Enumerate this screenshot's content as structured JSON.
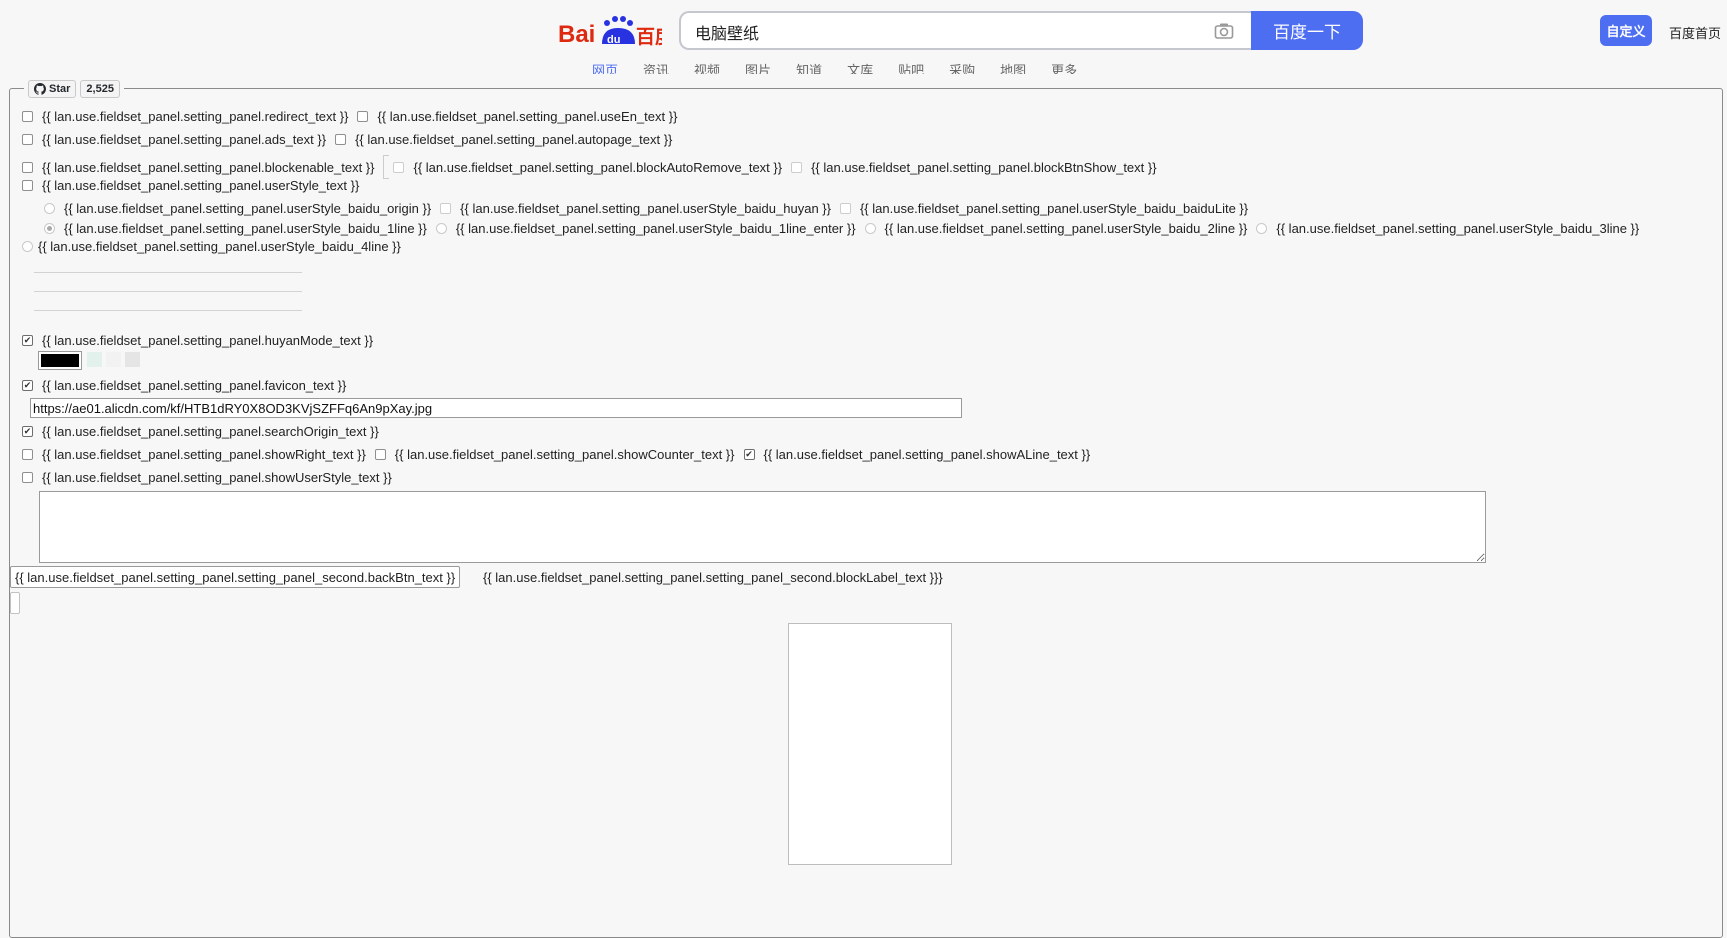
{
  "header": {
    "logo_text": "Bai du 百度",
    "search_value": "电脑壁纸",
    "search_button": "百度一下",
    "customize_button": "自定义",
    "home_link": "百度首页",
    "nav_tabs": [
      "网页",
      "资讯",
      "视频",
      "图片",
      "知道",
      "文库",
      "贴吧",
      "采购",
      "地图",
      "更多"
    ]
  },
  "github": {
    "star_label": "Star",
    "star_count": "2,525"
  },
  "settings": {
    "redirect": "{{ lan.use.fieldset_panel.setting_panel.redirect_text }}",
    "useEn": "{{ lan.use.fieldset_panel.setting_panel.useEn_text }}",
    "ads": "{{ lan.use.fieldset_panel.setting_panel.ads_text }}",
    "autopage": "{{ lan.use.fieldset_panel.setting_panel.autopage_text }}",
    "blockenable": "{{ lan.use.fieldset_panel.setting_panel.blockenable_text }}",
    "blockAutoRemove": "{{ lan.use.fieldset_panel.setting_panel.blockAutoRemove_text }}",
    "blockBtnShow": "{{ lan.use.fieldset_panel.setting_panel.blockBtnShow_text }}",
    "userStyle": "{{ lan.use.fieldset_panel.setting_panel.userStyle_text }}",
    "userStyle_baidu_origin": "{{ lan.use.fieldset_panel.setting_panel.userStyle_baidu_origin }}",
    "userStyle_baidu_huyan": "{{ lan.use.fieldset_panel.setting_panel.userStyle_baidu_huyan }}",
    "userStyle_baidu_baiduLite": "{{ lan.use.fieldset_panel.setting_panel.userStyle_baidu_baiduLite }}",
    "userStyle_baidu_1line": "{{ lan.use.fieldset_panel.setting_panel.userStyle_baidu_1line }}",
    "userStyle_baidu_1line_enter": "{{ lan.use.fieldset_panel.setting_panel.userStyle_baidu_1line_enter }}",
    "userStyle_baidu_2line": "{{ lan.use.fieldset_panel.setting_panel.userStyle_baidu_2line }}",
    "userStyle_baidu_3line": "{{ lan.use.fieldset_panel.setting_panel.userStyle_baidu_3line }}",
    "userStyle_baidu_4line": "{{ lan.use.fieldset_panel.setting_panel.userStyle_baidu_4line }}",
    "huyanMode": "{{ lan.use.fieldset_panel.setting_panel.huyanMode_text }}",
    "favicon": "{{ lan.use.fieldset_panel.setting_panel.favicon_text }}",
    "favicon_url": "https://ae01.alicdn.com/kf/HTB1dRY0X8OD3KVjSZFFq6An9pXay.jpg",
    "searchOrigin": "{{ lan.use.fieldset_panel.setting_panel.searchOrigin_text }}",
    "showRight": "{{ lan.use.fieldset_panel.setting_panel.showRight_text }}",
    "showCounter": "{{ lan.use.fieldset_panel.setting_panel.showCounter_text }}",
    "showALine": "{{ lan.use.fieldset_panel.setting_panel.showALine_text }}",
    "showUserStyle": "{{ lan.use.fieldset_panel.setting_panel.showUserStyle_text }}",
    "backBtn": "{{ lan.use.fieldset_panel.setting_panel.setting_panel_second.backBtn_text }}",
    "blockLabel": "{{ lan.use.fieldset_panel.setting_panel.setting_panel_second.blockLabel_text }}}"
  },
  "colors": {
    "accent": "#4e6ef2",
    "huyan_swatches": [
      "#000000",
      "#e3f1ed",
      "#f2f2f2",
      "#e5e5e5"
    ]
  }
}
